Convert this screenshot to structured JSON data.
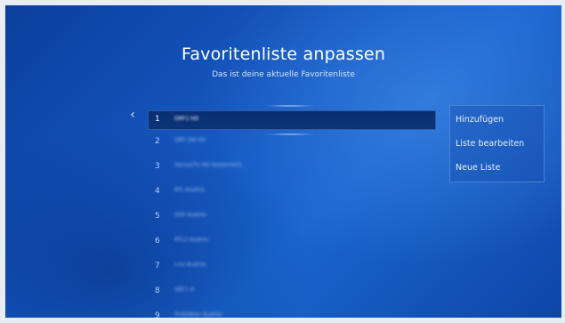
{
  "header": {
    "title": "Favoritenliste anpassen",
    "subtitle": "Das ist deine aktuelle Favoritenliste"
  },
  "icons": {
    "back": "chevron-left-icon"
  },
  "channels": [
    {
      "num": "1",
      "name": "ORF1 HD"
    },
    {
      "num": "2",
      "name": "ORF 2W HD"
    },
    {
      "num": "3",
      "name": "ServusTV HD Oesterreich"
    },
    {
      "num": "4",
      "name": "RTL Austria"
    },
    {
      "num": "5",
      "name": "VOX Austria"
    },
    {
      "num": "6",
      "name": "RTL2 Austria"
    },
    {
      "num": "7",
      "name": "n-tv Austria"
    },
    {
      "num": "8",
      "name": "SAT.1 A"
    },
    {
      "num": "9",
      "name": "ProSieben Austria"
    }
  ],
  "menu": {
    "add": "Hinzufügen",
    "edit": "Liste bearbeiten",
    "new": "Neue Liste"
  },
  "colors": {
    "background": "#1557c0",
    "selected_row": "#0a2f73"
  }
}
